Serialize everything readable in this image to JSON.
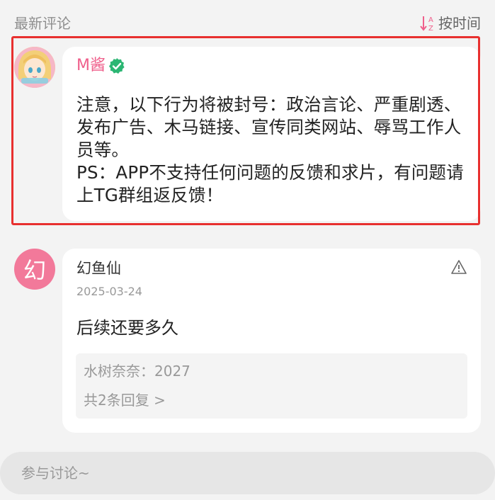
{
  "header": {
    "section_title": "最新评论",
    "sort_label": "按时间",
    "sort_icon": "sort-az-icon"
  },
  "comments": [
    {
      "author": "M酱",
      "verified": true,
      "avatar": "anime-avatar-image",
      "text": "注意，以下行为将被封号：政治言论、严重剧透、发布广告、木马链接、宣传同类网站、辱骂工作人员等。\nPS：APP不支持任何问题的反馈和求片，有问题请上TG群组返反馈！",
      "highlighted": true
    },
    {
      "author": "幻鱼仙",
      "avatar_letter": "幻",
      "date": "2025-03-24",
      "text": "后续还要多久",
      "reply_preview": "水树奈奈：2027",
      "reply_count_label": "共2条回复 >"
    }
  ],
  "input": {
    "placeholder": "参与讨论~"
  },
  "colors": {
    "accent_pink": "#ef5f8b",
    "avatar_pink": "#f2799a",
    "verified_green": "#2bb673",
    "highlight_red": "#e8302f"
  }
}
